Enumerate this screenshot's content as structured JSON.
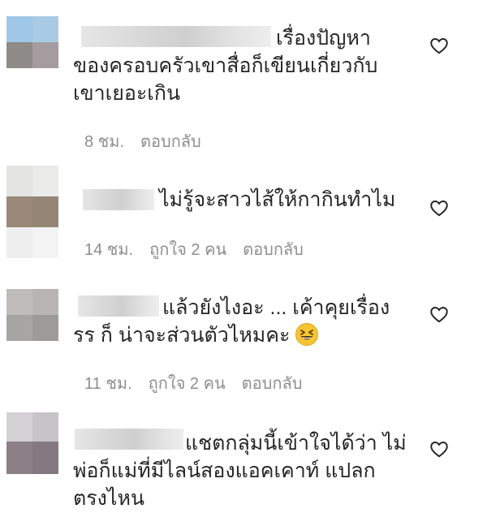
{
  "comments": [
    {
      "text": "เรื่องปัญหา\nของครอบครัวเขาสื่อก็เขียนเกี่ยวกับ\nเขาเยอะเกิน",
      "time": "8 ชม.",
      "likes": "",
      "reply": "ตอบกลับ",
      "avatar_colors": [
        "#9ec7e8",
        "#a9cbe6",
        "#8e8a88",
        "#a49c9f"
      ]
    },
    {
      "text": "ไม่รู้จะสาวไส้ให้กากินทำไม",
      "time": "14 ชม.",
      "likes": "ถูกใจ 2 คน",
      "reply": "ตอบกลับ",
      "avatar_colors": [
        "#e4e4e2",
        "#ebebea",
        "#9a8878",
        "#958574",
        "#eeeeee",
        "#f3f3f3"
      ]
    },
    {
      "text": "แล้วยังไงอะ ... เค้าคุยเรื่อง\nรร ก็ น่าจะส่วนตัวไหมคะ",
      "time": "11 ชม.",
      "likes": "ถูกใจ 2 คน",
      "reply": "ตอบกลับ",
      "avatar_colors": [
        "#c0bcbc",
        "#b9b4b4",
        "#a7a4a4",
        "#9d9a9a"
      ]
    },
    {
      "text": "แชตกลุ่มนี้เข้าใจได้ว่า ไม่\nพ่อก็แม่ที่มีไลน์สองแอคเคาท์ แปลก\nตรงไหน",
      "time": "",
      "likes": "",
      "reply": "",
      "avatar_colors": [
        "#d3d1d3",
        "#c6c4c6",
        "#8c8086",
        "#857880"
      ]
    }
  ],
  "colors": {
    "text": "#262626",
    "meta": "#8e8e8e",
    "background": "#ffffff"
  },
  "icons": {
    "like": "heart-outline-icon",
    "emoji": "grinning-squinting-face"
  }
}
